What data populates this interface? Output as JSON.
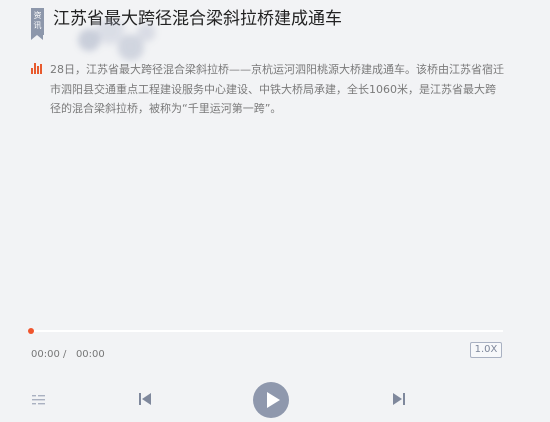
{
  "article": {
    "tag_line1": "资",
    "tag_line2": "讯",
    "title": "江苏省最大跨径混合梁斜拉桥建成通车",
    "summary": "28日，江苏省最大跨径混合梁斜拉桥——京杭运河泗阳桃源大桥建成通车。该桥由江苏省宿迁市泗阳县交通重点工程建设服务中心建设、中铁大桥局承建，全长1060米，是江苏省最大跨径的混合梁斜拉桥，被称为“千里运河第一跨”。"
  },
  "player": {
    "current_time": "00:00",
    "separator": "/",
    "total_time": "00:00",
    "speed": "1.0X",
    "progress": 0
  },
  "colors": {
    "accent": "#f0552d",
    "control": "#8f98ad",
    "background": "#f2f3f5"
  },
  "icons": {
    "tag": "news-tag-icon",
    "audio": "audio-bars-icon",
    "playlist": "playlist-icon",
    "prev": "skip-previous-icon",
    "play": "play-icon",
    "next": "skip-next-icon"
  }
}
